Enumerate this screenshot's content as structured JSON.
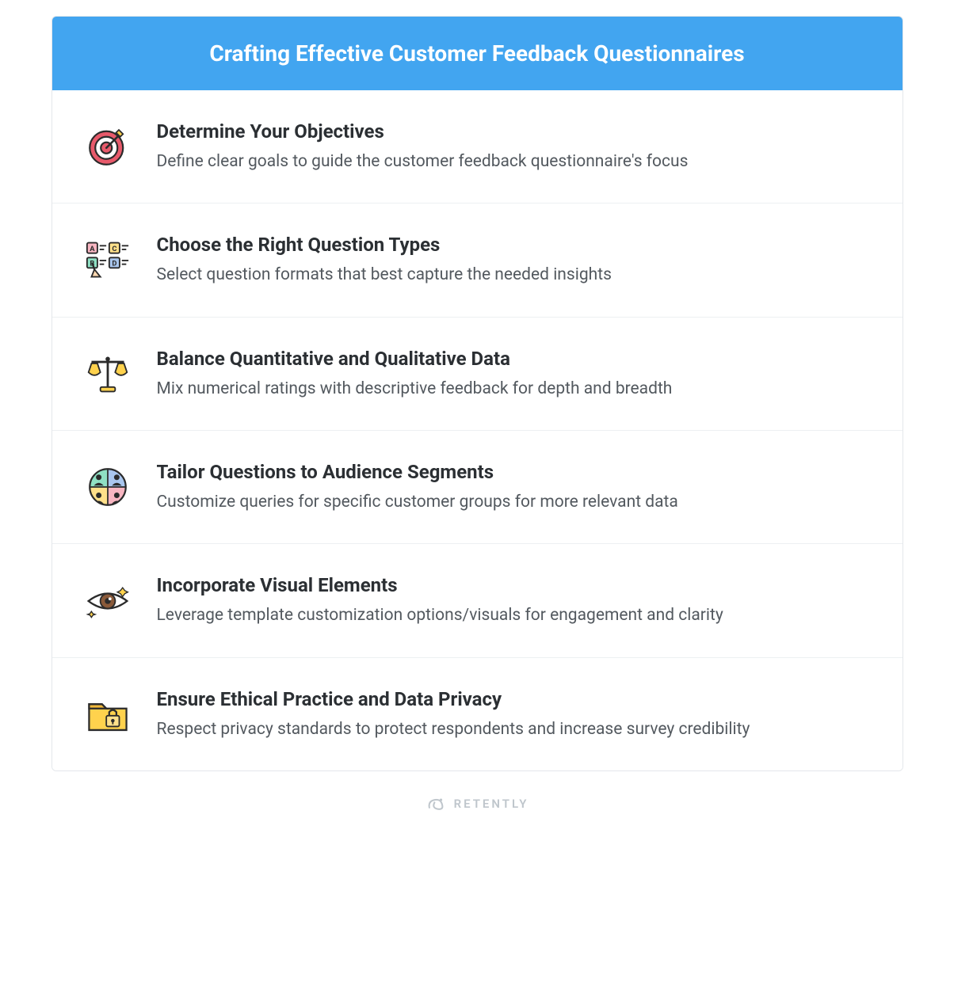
{
  "header": {
    "title": "Crafting Effective Customer Feedback Questionnaires"
  },
  "items": [
    {
      "icon": "target-icon",
      "title": "Determine Your Objectives",
      "description": "Define clear goals to guide the customer feedback questionnaire's focus"
    },
    {
      "icon": "question-types-icon",
      "title": "Choose the Right Question Types",
      "description": "Select question formats that best capture the needed insights"
    },
    {
      "icon": "balance-scale-icon",
      "title": "Balance Quantitative and Qualitative Data",
      "description": "Mix numerical ratings with descriptive feedback for depth and breadth"
    },
    {
      "icon": "audience-segments-icon",
      "title": "Tailor Questions to Audience Segments",
      "description": "Customize queries for specific customer groups for more relevant data"
    },
    {
      "icon": "eye-icon",
      "title": "Incorporate Visual Elements",
      "description": "Leverage template customization options/visuals for engagement and clarity"
    },
    {
      "icon": "lock-folder-icon",
      "title": "Ensure Ethical Practice and Data Privacy",
      "description": "Respect privacy standards to protect respondents and increase survey credibility"
    }
  ],
  "footer": {
    "brand": "RETENTLY"
  }
}
